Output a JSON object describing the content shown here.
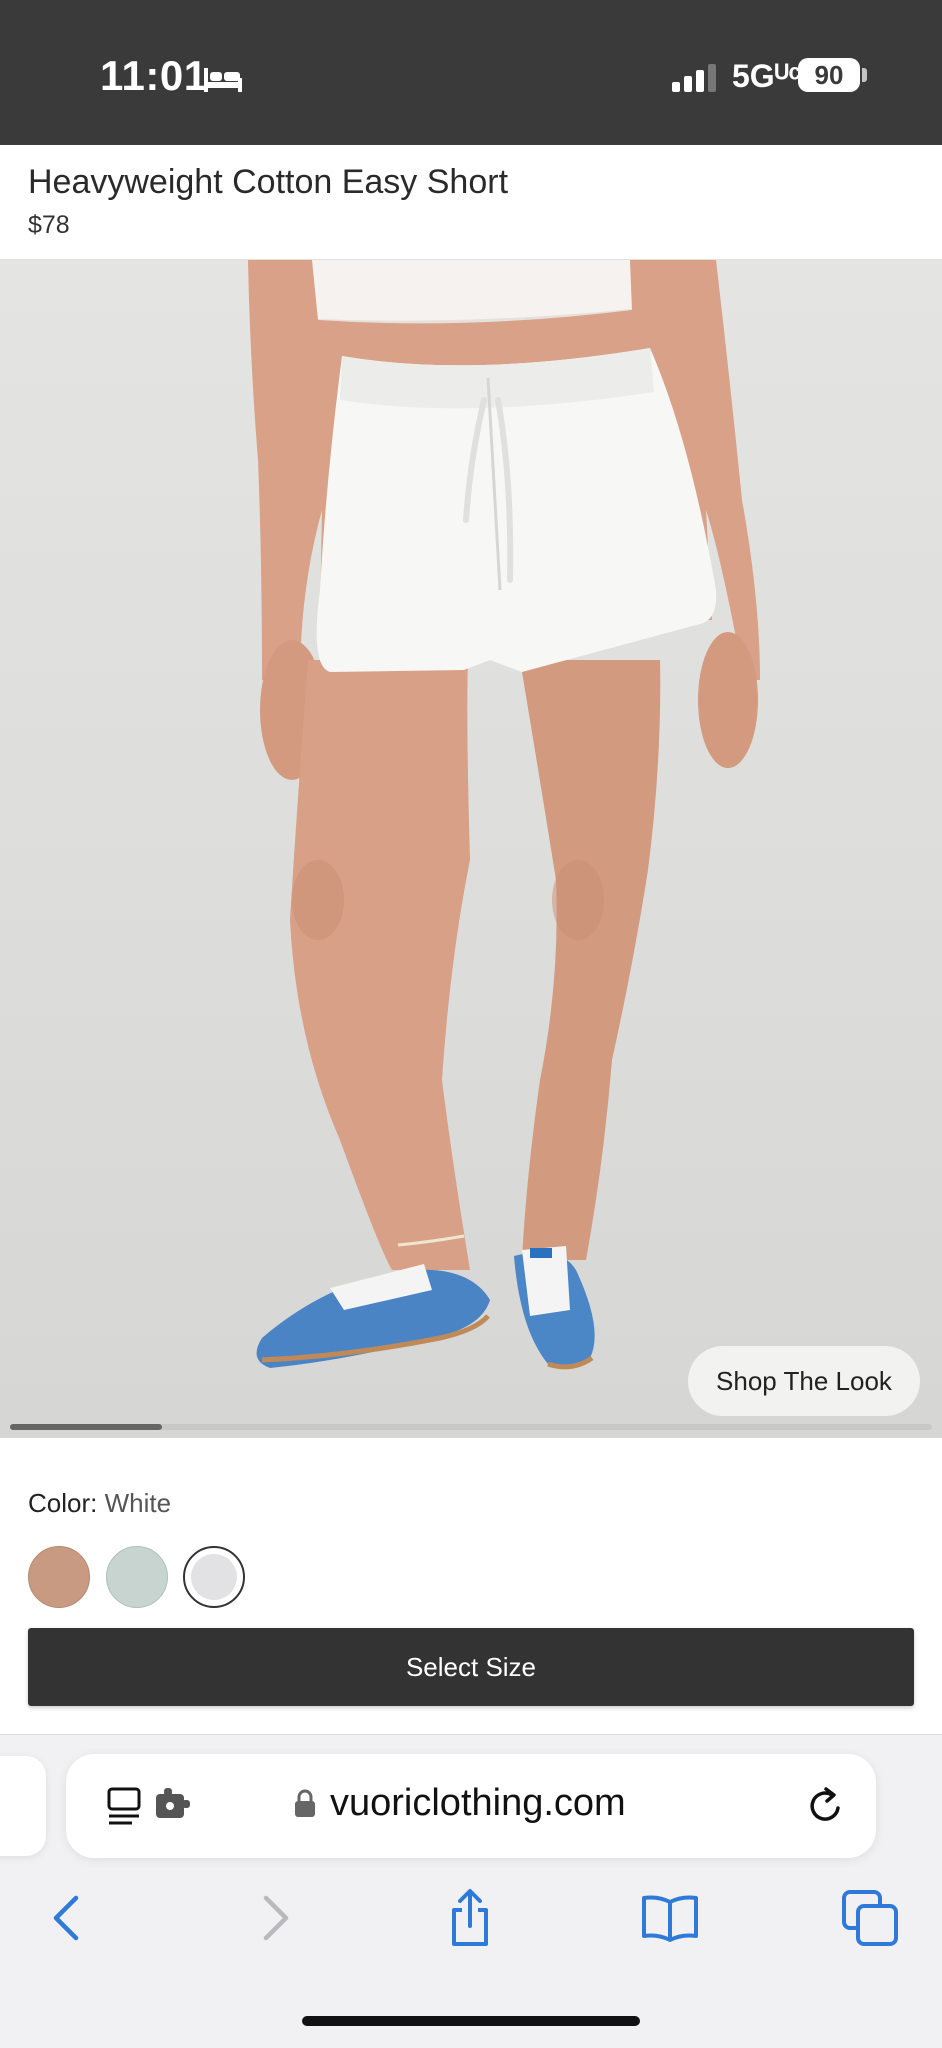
{
  "status_bar": {
    "time": "11:01",
    "network": "5Gᵁᶜ",
    "battery": "90"
  },
  "product": {
    "title": "Heavyweight Cotton Easy Short",
    "price": "$78"
  },
  "hero": {
    "shop_the_look_label": "Shop The Look",
    "carousel_position": 0.16
  },
  "color": {
    "label": "Color",
    "separator": ": ",
    "selected": "White",
    "swatches": [
      {
        "name": "tan",
        "color": "#c89a82"
      },
      {
        "name": "sage",
        "color": "#c7d4cf"
      },
      {
        "name": "white",
        "color": "#e2e2e4",
        "selected": true
      }
    ]
  },
  "actions": {
    "select_size_label": "Select Size"
  },
  "browser": {
    "url": "vuoriclothing.com",
    "icons": [
      "reader-icon",
      "extension-icon",
      "lock-icon",
      "reload-icon",
      "back-icon",
      "forward-icon",
      "share-icon",
      "bookmarks-icon",
      "tabs-icon"
    ],
    "accent": "#2f7ad8"
  }
}
